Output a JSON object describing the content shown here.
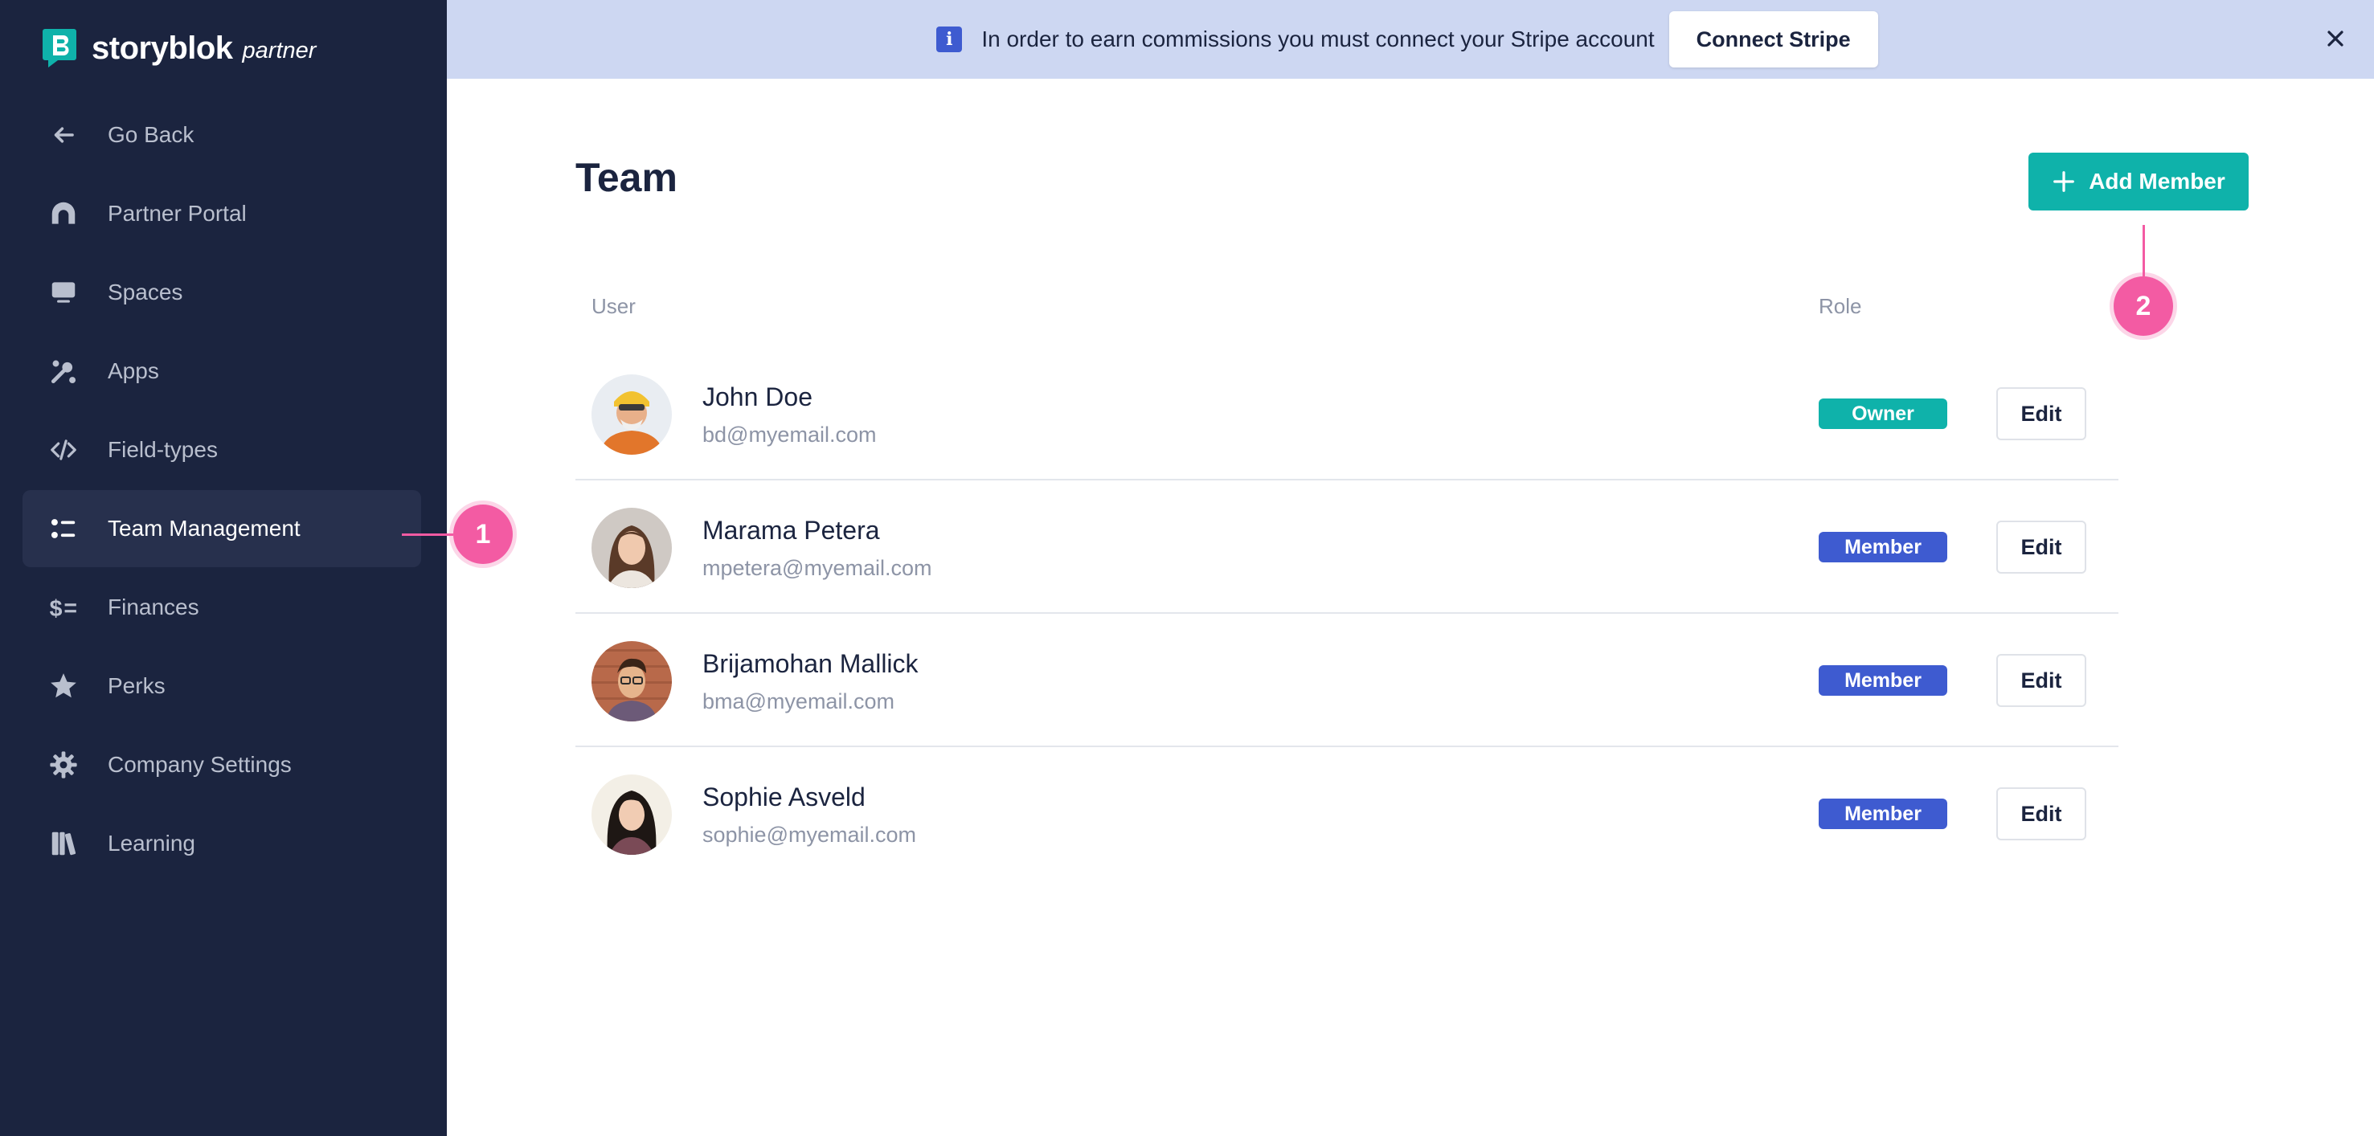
{
  "brand": {
    "name": "storyblok",
    "sub": "partner"
  },
  "sidebar": {
    "items": [
      {
        "label": "Go Back",
        "icon": "arrow-left-icon"
      },
      {
        "label": "Partner Portal",
        "icon": "portal-icon"
      },
      {
        "label": "Spaces",
        "icon": "monitor-icon"
      },
      {
        "label": "Apps",
        "icon": "apps-icon"
      },
      {
        "label": "Field-types",
        "icon": "code-icon"
      },
      {
        "label": "Team Management",
        "icon": "team-list-icon",
        "active": true
      },
      {
        "label": "Finances",
        "icon": "dollar-icon"
      },
      {
        "label": "Perks",
        "icon": "star-icon"
      },
      {
        "label": "Company Settings",
        "icon": "gear-icon"
      },
      {
        "label": "Learning",
        "icon": "books-icon"
      }
    ]
  },
  "banner": {
    "text": "In order to earn commissions you must connect your Stripe account",
    "button": "Connect Stripe"
  },
  "main": {
    "title": "Team",
    "add_button": "Add Member",
    "columns": {
      "user": "User",
      "role": "Role"
    },
    "members": [
      {
        "name": "John Doe",
        "email": "bd@myemail.com",
        "role": "Owner",
        "edit": "Edit"
      },
      {
        "name": "Marama Petera",
        "email": "mpetera@myemail.com",
        "role": "Member",
        "edit": "Edit"
      },
      {
        "name": "Brijamohan Mallick",
        "email": "bma@myemail.com",
        "role": "Member",
        "edit": "Edit"
      },
      {
        "name": "Sophie Asveld",
        "email": "sophie@myemail.com",
        "role": "Member",
        "edit": "Edit"
      }
    ]
  },
  "annotations": {
    "one": "1",
    "two": "2"
  },
  "colors": {
    "sidebar_bg": "#1b243f",
    "banner_bg": "#cdd7f2",
    "accent_teal": "#0fb2aa",
    "member_blue": "#3e5bd0",
    "annotation_pink": "#f35ba3"
  }
}
